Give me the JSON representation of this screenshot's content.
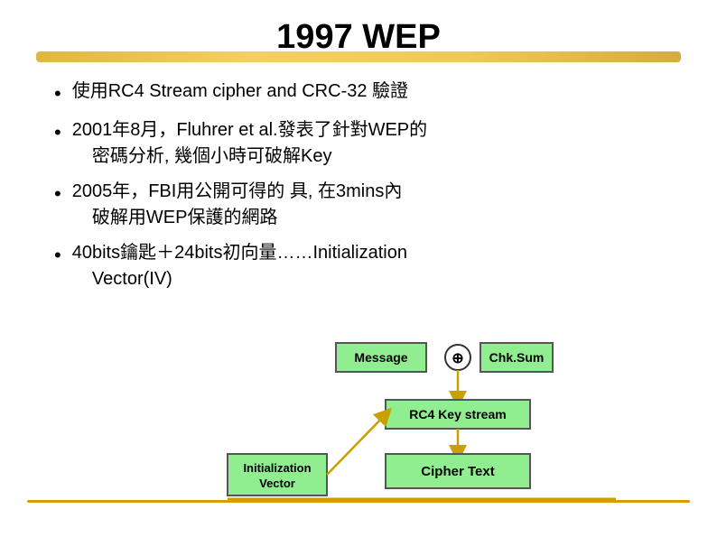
{
  "slide": {
    "title": "1997 WEP",
    "bullets": [
      {
        "text": "使用RC4 Stream cipher and CRC-32 驗證"
      },
      {
        "text": "2001年8月，Fluhrer et al.發表了針對WEP的　密碼分析, 幾個小時可破解Key"
      },
      {
        "text": "2005年，FBI用公開可得的 具, 在3mins內　破解用WEP保護的網路"
      },
      {
        "text": "40bits鑰匙＋24bits初向量……Initialization　Vector(IV)"
      }
    ],
    "diagram": {
      "message_label": "Message",
      "chksum_label": "Chk.Sum",
      "rc4_label": "RC4 Key stream",
      "cipher_label": "Cipher Text",
      "iv_label": "Initialization\nVector"
    }
  }
}
